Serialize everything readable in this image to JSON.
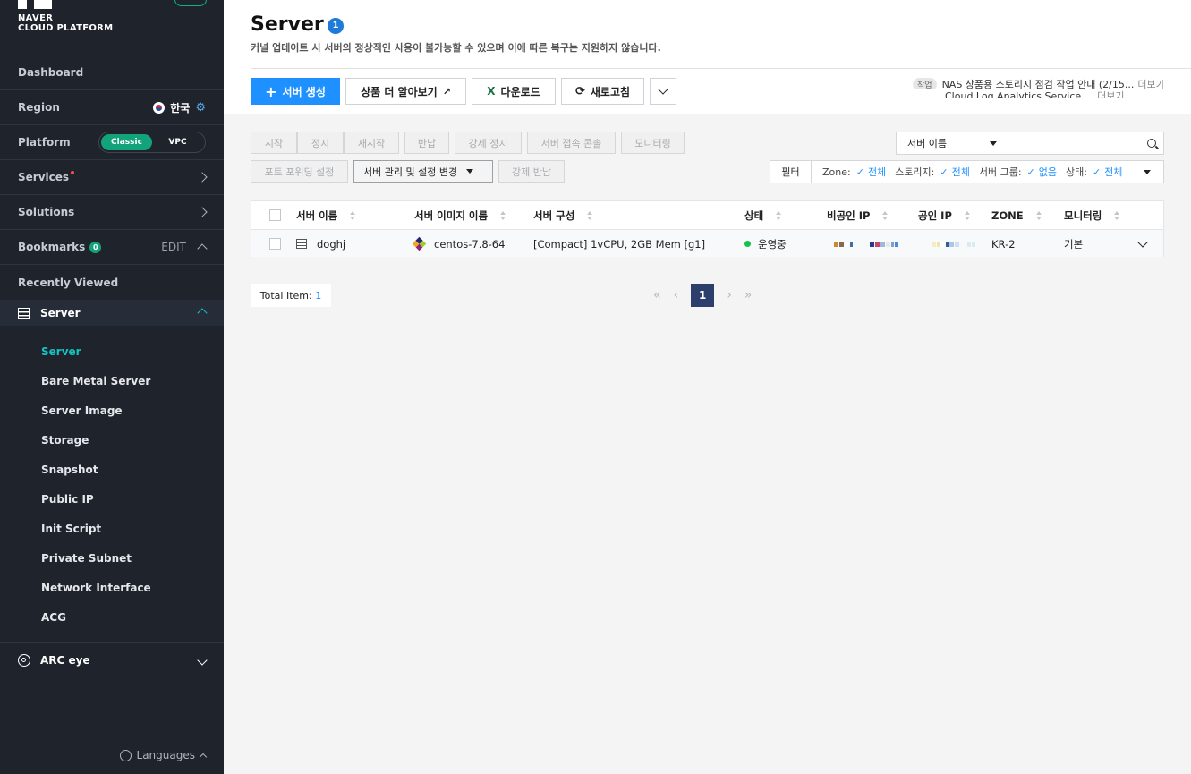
{
  "sidebar": {
    "brand_line1": "NAVER",
    "brand_line2": "CLOUD PLATFORM",
    "dashboard": "Dashboard",
    "region_label": "Region",
    "region_value": "한국",
    "platform_label": "Platform",
    "platform_options": [
      "Classic",
      "VPC"
    ],
    "platform_selected": "Classic",
    "services": "Services",
    "solutions": "Solutions",
    "bookmarks": "Bookmarks",
    "bookmarks_count": "0",
    "bookmarks_edit": "EDIT",
    "recently_viewed": "Recently Viewed",
    "server_group": "Server",
    "server_items": [
      "Server",
      "Bare Metal Server",
      "Server Image",
      "Storage",
      "Snapshot",
      "Public IP",
      "Init Script",
      "Private Subnet",
      "Network Interface",
      "ACG"
    ],
    "active_item": "Server",
    "arc_eye": "ARC eye",
    "languages": "Languages"
  },
  "header": {
    "title": "Server",
    "title_badge": "1",
    "subtitle": "커널 업데이트 시 서버의 정상적인 사용이 불가능할 수 있으며 이에 따른 복구는 지원하지 않습니다."
  },
  "toolbar": {
    "create": "서버 생성",
    "learn_more": "상품 더 알아보기",
    "download": "다운로드",
    "refresh": "새로고침"
  },
  "notice": {
    "tag1": "작업",
    "line1": "NAS 상품용 스토리지 점검 작업 안내 (2/15...",
    "more1": "더보기",
    "line2": "Cloud Log Analytics Service ...",
    "more2": "더보기"
  },
  "actions": {
    "start": "시작",
    "stop": "정지",
    "restart": "재시작",
    "return": "반납",
    "force_stop": "강제 정지",
    "console": "서버 접속 콘솔",
    "monitoring": "모니터링",
    "port_forwarding": "포트 포워딩 설정",
    "manage": "서버 관리 및 설정 변경",
    "force_return": "강제 반납"
  },
  "search": {
    "select": "서버 이름",
    "value": ""
  },
  "filter": {
    "button": "필터",
    "zone_label": "Zone:",
    "zone_value": "전체",
    "storage_label": "스토리지:",
    "storage_value": "전체",
    "group_label": "서버 그룹:",
    "group_value": "없음",
    "status_label": "상태:",
    "status_value": "전체"
  },
  "table": {
    "headers": [
      "서버 이름",
      "서버 이미지 이름",
      "서버 구성",
      "상태",
      "비공인 IP",
      "공인 IP",
      "ZONE",
      "모니터링"
    ],
    "rows": [
      {
        "name": "doghj",
        "image": "centos-7.8-64",
        "spec": "[Compact] 1vCPU, 2GB Mem [g1]",
        "status": "운영중",
        "zone": "KR-2",
        "monitoring": "기본"
      }
    ]
  },
  "pagination": {
    "total_label": "Total Item:",
    "total_value": "1",
    "current": "1"
  },
  "colors": {
    "accent": "#1e90ff",
    "sidebar_bg": "#1e232c",
    "active_teal": "#14c2c2",
    "status_green": "#13c24c"
  }
}
